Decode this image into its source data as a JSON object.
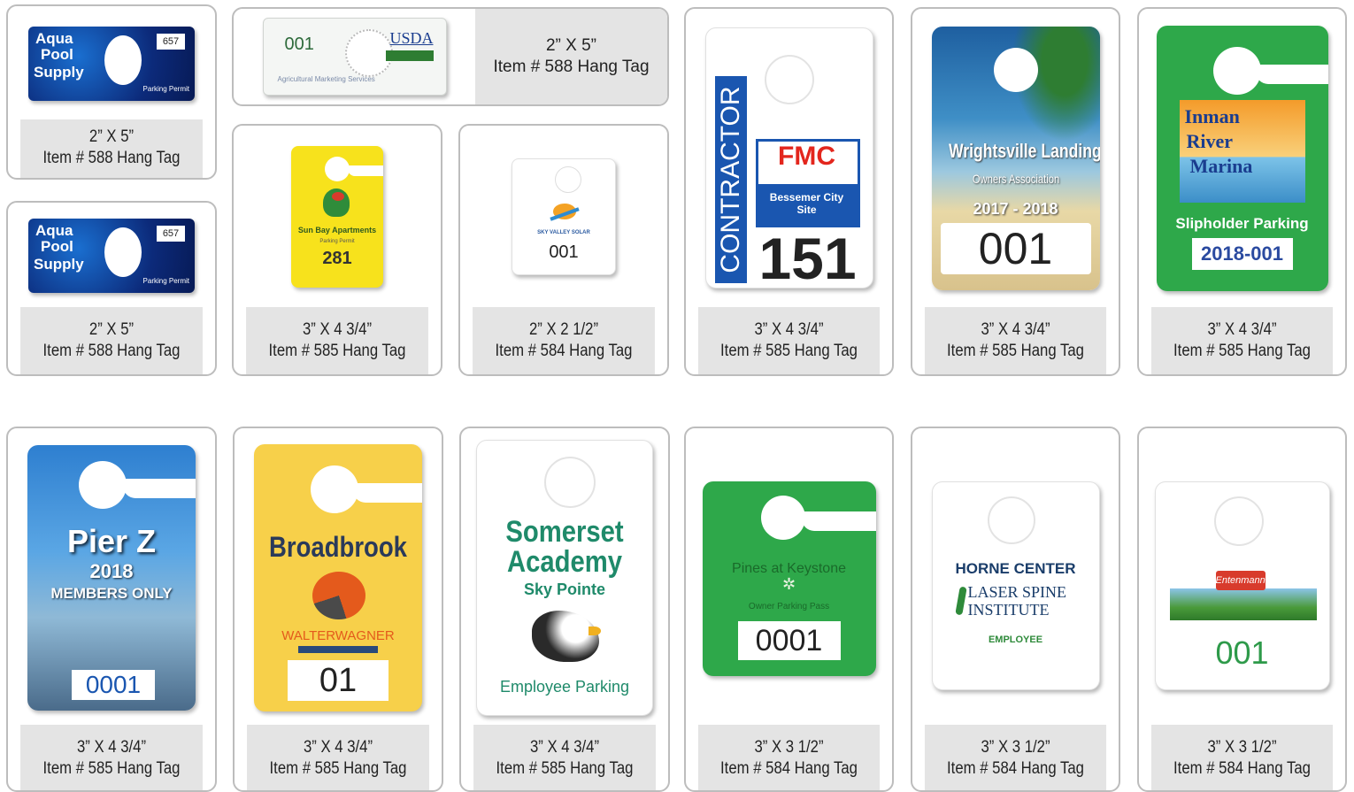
{
  "tags": [
    {
      "size": "2” X 5”",
      "item": "Item # 588 Hang Tag",
      "lines": [
        "Aqua",
        "Pool",
        "Supply",
        "657",
        "Parking Permit"
      ]
    },
    {
      "size": "2” X 5”",
      "item": "Item # 588 Hang Tag",
      "lines": [
        "001",
        "USDA",
        "Agricultural Marketing Services"
      ]
    },
    {
      "size": "2” X 5”",
      "item": "Item # 588 Hang Tag",
      "lines": [
        "Aqua",
        "Pool",
        "Supply",
        "657",
        "Parking Permit"
      ]
    },
    {
      "size": "3” X 4 3/4”",
      "item": "Item # 585 Hang Tag",
      "lines": [
        "Sun Bay Apartments",
        "Parking Permit",
        "281"
      ]
    },
    {
      "size": "2” X 2 1/2”",
      "item": "Item # 584 Hang Tag",
      "lines": [
        "SKY VALLEY SOLAR",
        "001"
      ]
    },
    {
      "size": "3” X 4 3/4”",
      "item": "Item # 585 Hang Tag",
      "lines": [
        "CONTRACTOR",
        "FMC",
        "Bessemer City Site",
        "151"
      ]
    },
    {
      "size": "3” X 4 3/4”",
      "item": "Item # 585 Hang Tag",
      "lines": [
        "Wrightsville Landing",
        "Owners Association",
        "2017 - 2018",
        "001"
      ]
    },
    {
      "size": "3” X 4 3/4”",
      "item": "Item # 585 Hang Tag",
      "lines": [
        "Inman",
        "River",
        "Marina",
        "Slipholder Parking",
        "2018-001"
      ]
    },
    {
      "size": "3” X 4 3/4”",
      "item": "Item # 585 Hang Tag",
      "lines": [
        "Pier Z",
        "2018",
        "MEMBERS ONLY",
        "0001"
      ]
    },
    {
      "size": "3” X 4 3/4”",
      "item": "Item # 585 Hang Tag",
      "lines": [
        "Broadbrook",
        "WALTERWAGNER",
        "01"
      ]
    },
    {
      "size": "3” X 4 3/4”",
      "item": "Item # 585 Hang Tag",
      "lines": [
        "Somerset",
        "Academy",
        "Sky Pointe",
        "Employee Parking"
      ]
    },
    {
      "size": "3” X 3 1/2”",
      "item": "Item # 584 Hang Tag",
      "lines": [
        "Pines at Keystone",
        "Owner Parking Pass",
        "0001"
      ]
    },
    {
      "size": "3” X 3 1/2”",
      "item": "Item # 584 Hang Tag",
      "lines": [
        "HORNE CENTER",
        "LASER SPINE",
        "INSTITUTE",
        "EMPLOYEE"
      ]
    },
    {
      "size": "3” X 3 1/2”",
      "item": "Item # 584 Hang Tag",
      "lines": [
        "Entenmann",
        "001"
      ]
    }
  ]
}
